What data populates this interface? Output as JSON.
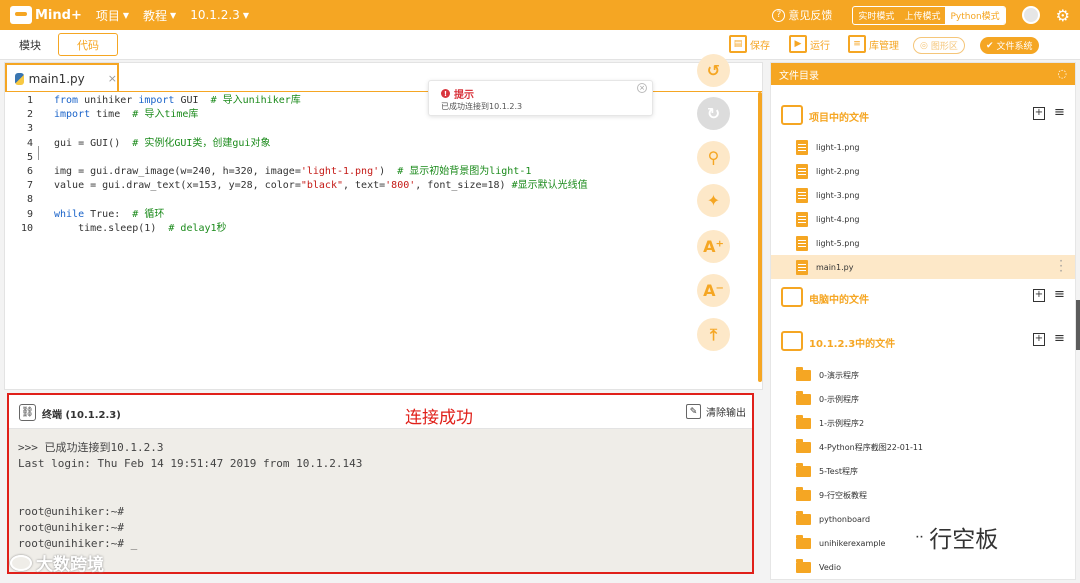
{
  "topbar": {
    "logo": "Mind+",
    "menus": [
      {
        "label": "项目"
      },
      {
        "label": "教程"
      },
      {
        "label": "10.1.2.3"
      }
    ],
    "feedback": "意见反馈",
    "modes": [
      "实时模式",
      "上传模式",
      "Python模式"
    ],
    "active_mode": "Python模式"
  },
  "toolbar": {
    "tab_modules": "模块",
    "tab_code": "代码",
    "save": "保存",
    "run": "运行",
    "libs": "库管理",
    "graphics": "图形区",
    "filesystem": "文件系统"
  },
  "editor": {
    "tab_name": "main1.py",
    "line_numbers": [
      "1",
      "2",
      "3",
      "4",
      "5",
      "6",
      "7",
      "8",
      "9",
      "10"
    ],
    "code": {
      "l1a": "from",
      "l1b": " unihiker ",
      "l1c": "import",
      "l1d": " GUI  ",
      "l1e": "# 导入unihiker库",
      "l2a": "import",
      "l2b": " time  ",
      "l2c": "# 导入time库",
      "l4a": "gui = GUI()  ",
      "l4b": "# 实例化GUI类，创建gui对象",
      "l6a": "img = gui.draw_image(w=240, h=320, image=",
      "l6b": "'light-1.png'",
      "l6c": ")  ",
      "l6d": "# 显示初始背景图为light-1",
      "l7a": "value = gui.draw_text(x=153, y=28, color=",
      "l7b": "\"black\"",
      "l7c": ", text=",
      "l7d": "'800'",
      "l7e": ", font_size=18) ",
      "l7f": "#显示默认光线值",
      "l9a": "while",
      "l9b": " True:  ",
      "l9c": "# 循环",
      "l10a": "    time.sleep(1)  ",
      "l10b": "# delay1秒"
    }
  },
  "toast": {
    "title": "提示",
    "message": "已成功连接到10.1.2.3"
  },
  "terminal": {
    "title": "终端 (10.1.2.3)",
    "status_annotation": "连接成功",
    "clear_label": "清除输出",
    "lines": [
      ">>> 已成功连接到10.1.2.3",
      "Last login: Thu Feb 14 19:51:47 2019 from 10.1.2.143",
      "",
      "",
      "root@unihiker:~#",
      "root@unihiker:~#",
      "root@unihiker:~# _"
    ]
  },
  "file_panel": {
    "header": "文件目录",
    "sections": {
      "project": "项目中的文件",
      "computer": "电脑中的文件",
      "device": "10.1.2.3中的文件"
    },
    "project_files": [
      "light-1.png",
      "light-2.png",
      "light-3.png",
      "light-4.png",
      "light-5.png",
      "main1.py"
    ],
    "selected_file": "main1.py",
    "device_folders": [
      "0-演示程序",
      "0-示例程序",
      "1-示例程序2",
      "4-Python程序截图22-01-11",
      "5-Test程序",
      "9-行空板教程",
      "pythonboard",
      "unihikerexample",
      "Vedio"
    ]
  },
  "watermarks": {
    "left": "大数跨境",
    "right": "行空板"
  },
  "colors": {
    "accent": "#f5a623",
    "alert": "#e0201a"
  }
}
